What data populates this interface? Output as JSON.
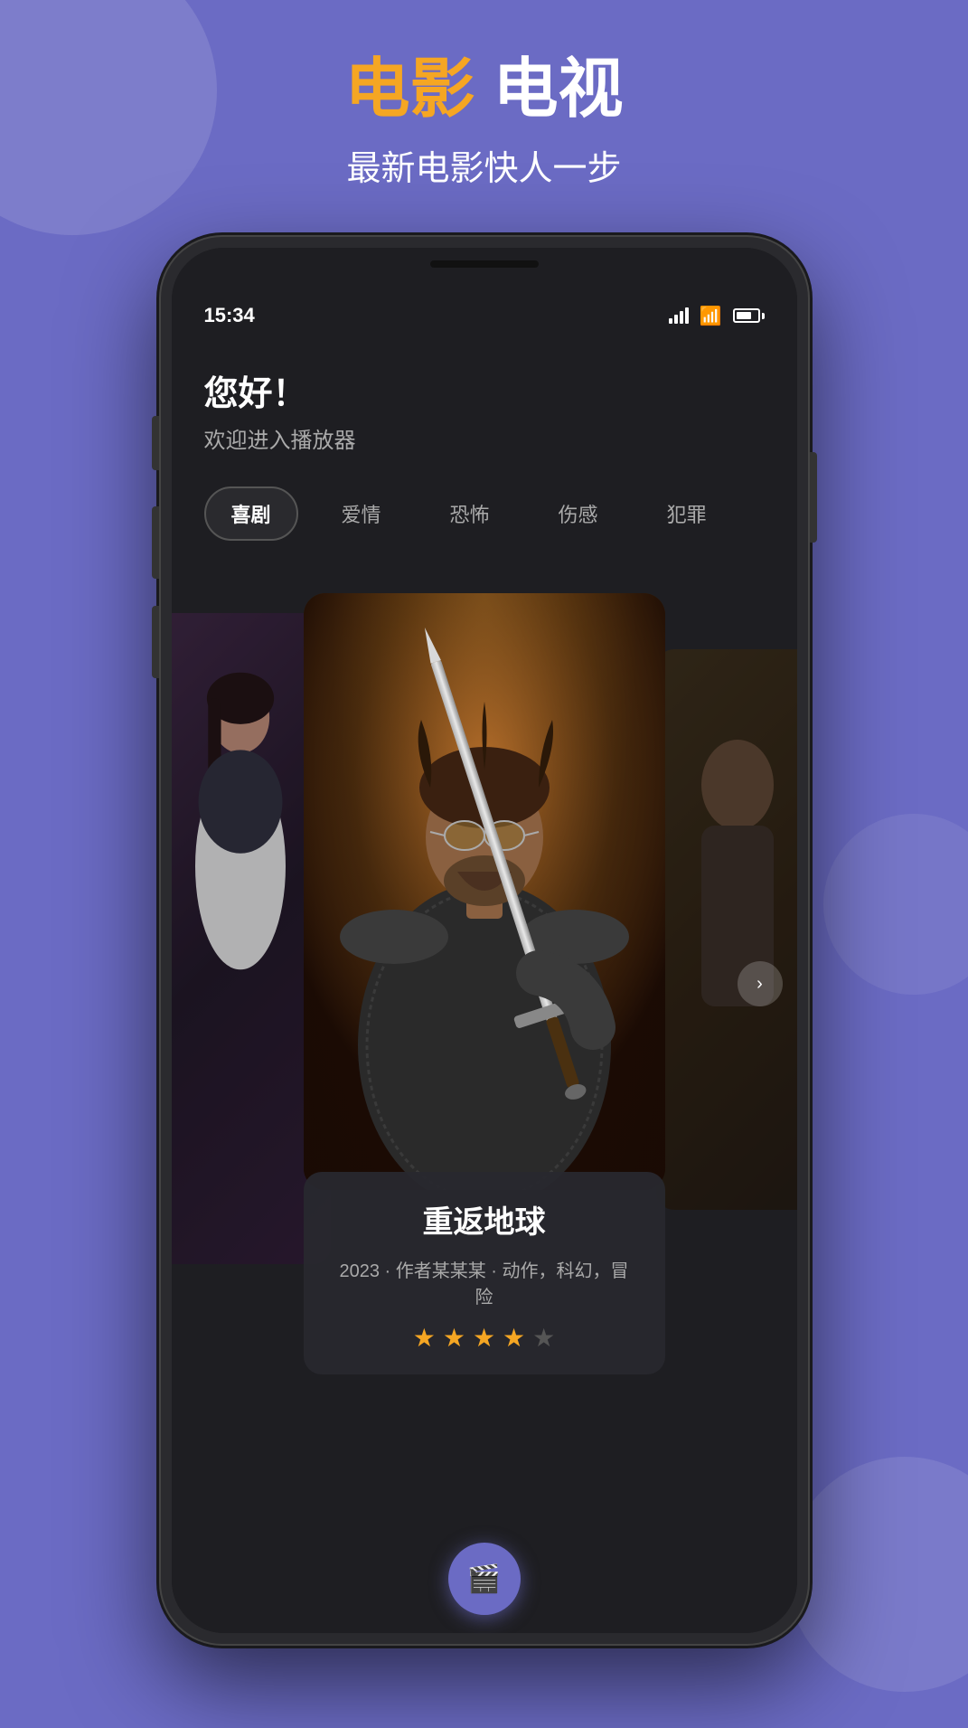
{
  "background": {
    "color": "#6b6bc4"
  },
  "header": {
    "title_movie": "电影",
    "title_tv": "电视",
    "subtitle": "最新电影快人一步"
  },
  "phone": {
    "status_bar": {
      "time": "15:34",
      "signal_label": "signal",
      "wifi_label": "wifi",
      "battery_label": "battery"
    },
    "greeting": {
      "title": "您好！",
      "subtitle": "欢迎进入播放器"
    },
    "genre_tabs": [
      {
        "label": "喜剧",
        "active": true
      },
      {
        "label": "爱情",
        "active": false
      },
      {
        "label": "恐怖",
        "active": false
      },
      {
        "label": "伤感",
        "active": false
      },
      {
        "label": "犯罪",
        "active": false
      }
    ],
    "featured_movie": {
      "title": "重返地球",
      "year": "2023",
      "author": "作者某某某",
      "genres": "动作，科幻，冒险",
      "rating": 4,
      "max_rating": 5,
      "meta_text": "2023 · 作者某某某 · 动作，科幻，冒险"
    },
    "bottom_nav": {
      "icon": "🎬"
    }
  }
}
